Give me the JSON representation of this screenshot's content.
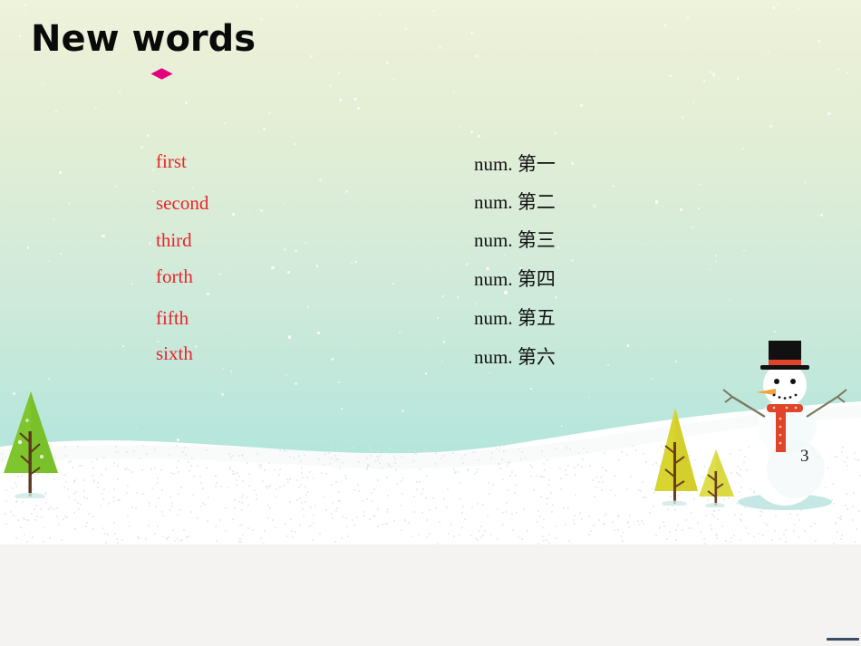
{
  "slide": {
    "title": "New words",
    "page_number": "3",
    "bullet_color": "#e3007f",
    "word_color": "#e8252a",
    "translation_color": "#111111",
    "background_top_color": "#eef3dc",
    "background_bottom_color": "#a4e3dc",
    "snow_color": "#ffffff"
  },
  "vocabulary": [
    {
      "word": "first",
      "translation": "num. 第一"
    },
    {
      "word": "second",
      "translation": "num. 第二"
    },
    {
      "word": "third",
      "translation": "num. 第三"
    },
    {
      "word": "forth",
      "translation": "num. 第四"
    },
    {
      "word": "fifth",
      "translation": "num. 第五"
    },
    {
      "word": "sixth",
      "translation": "num. 第六"
    }
  ],
  "decorations": {
    "snowman": {
      "hat_color": "#111111",
      "hat_band_color": "#e0452c",
      "scarf_color": "#e0452c",
      "nose_color": "#f0a23c",
      "body_color": "#ffffff"
    },
    "trees": [
      {
        "name": "green-tree-left",
        "canopy_color": "#7fc62e",
        "trunk_color": "#5a3a1e"
      },
      {
        "name": "yellow-tree-tall",
        "canopy_color": "#d8d430",
        "trunk_color": "#6b3f1c"
      },
      {
        "name": "yellow-tree-small",
        "canopy_color": "#dede4a",
        "trunk_color": "#6b3f1c"
      }
    ]
  }
}
